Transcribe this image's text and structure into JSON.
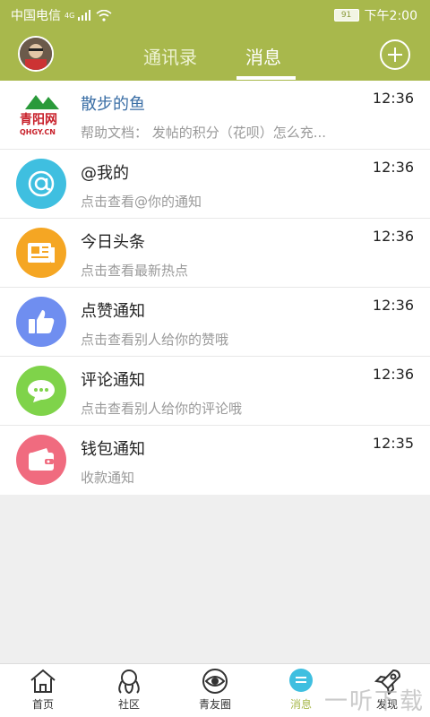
{
  "status_bar": {
    "carrier": "中国电信",
    "network": "4G",
    "battery": "91",
    "time": "下午2:00"
  },
  "header": {
    "tabs": [
      {
        "label": "通讯录",
        "active": false
      },
      {
        "label": "消息",
        "active": true
      }
    ],
    "add_icon": "plus-circle-icon"
  },
  "messages": [
    {
      "title": "散步的鱼",
      "subtitle": "帮助文档： 发帖的积分（花呗）怎么充...",
      "time": "12:36",
      "icon": "qingyang-logo",
      "logo_text": "青阳网",
      "logo_sub": "QHGY.CN"
    },
    {
      "title": "@我的",
      "subtitle": "点击查看@你的通知",
      "time": "12:36",
      "icon": "at-icon",
      "color": "#3fbfe0"
    },
    {
      "title": "今日头条",
      "subtitle": "点击查看最新热点",
      "time": "12:36",
      "icon": "newspaper-icon",
      "color": "#f5a623"
    },
    {
      "title": "点赞通知",
      "subtitle": "点击查看别人给你的赞哦",
      "time": "12:36",
      "icon": "thumbs-up-icon",
      "color": "#6f8ef0"
    },
    {
      "title": "评论通知",
      "subtitle": "点击查看别人给你的评论哦",
      "time": "12:36",
      "icon": "comment-icon",
      "color": "#7fd34a"
    },
    {
      "title": "钱包通知",
      "subtitle": "收款通知",
      "time": "12:35",
      "icon": "wallet-icon",
      "color": "#f06b7f"
    }
  ],
  "tabbar": [
    {
      "label": "首页",
      "icon": "home-icon"
    },
    {
      "label": "社区",
      "icon": "community-icon"
    },
    {
      "label": "青友圈",
      "icon": "eye-circle-icon"
    },
    {
      "label": "消息",
      "icon": "message-icon",
      "active": true
    },
    {
      "label": "发现",
      "icon": "rocket-icon"
    }
  ],
  "watermark": "一听下载",
  "colors": {
    "theme": "#a8b84c"
  }
}
